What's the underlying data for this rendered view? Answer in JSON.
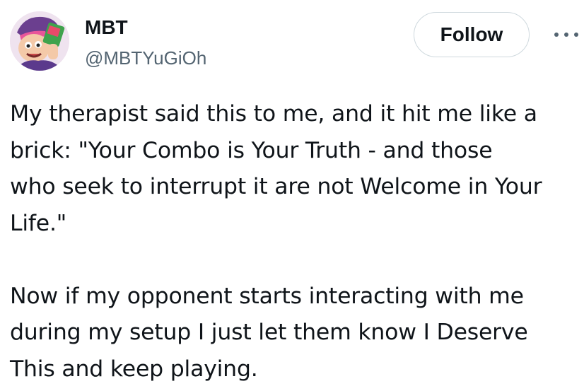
{
  "author": {
    "display_name": "MBT",
    "handle": "@MBTYuGiOh",
    "avatar_icon": "cartoon-character-avatar"
  },
  "actions": {
    "follow_label": "Follow",
    "more_icon": "more-horizontal-icon"
  },
  "tweet": {
    "paragraph_1": "My therapist said this to me, and it hit me like a\nbrick: \"Your Combo is Your Truth - and those\nwho seek to interrupt it are not Welcome in Your\nLife.\"",
    "paragraph_2": "Now if my opponent starts interacting with me\nduring my setup I just let them know I Deserve\nThis and keep playing."
  },
  "colors": {
    "text_primary": "#0f1419",
    "text_secondary": "#536471",
    "button_border": "#cfd9de"
  }
}
